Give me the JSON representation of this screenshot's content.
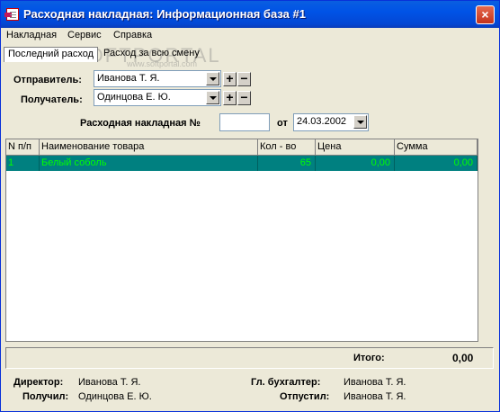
{
  "window": {
    "title": "Расходная накладная: Информационная база #1",
    "close_glyph": "×"
  },
  "menu": [
    "Накладная",
    "Сервис",
    "Справка"
  ],
  "tabs": [
    "Последний расход",
    "Расход за всю смену"
  ],
  "watermark": {
    "text": "SOFTPORTAL",
    "sub": "www.softportal.com"
  },
  "form": {
    "sender_label": "Отправитель:",
    "sender_value": "Иванова Т. Я.",
    "recipient_label": "Получатель:",
    "recipient_value": "Одинцова Е. Ю.",
    "plus_glyph": "+",
    "minus_glyph": "−",
    "invoice_label": "Расходная накладная №",
    "invoice_number": "",
    "date_label": "от",
    "date_value": "24.03.2002"
  },
  "grid": {
    "columns": [
      "N п/п",
      "Наименование товара",
      "Кол - во",
      "Цена",
      "Сумма"
    ],
    "rows": [
      {
        "n": "1",
        "name": "Белый соболь",
        "qty": "65",
        "price": "0,00",
        "sum": "0,00"
      }
    ]
  },
  "total": {
    "label": "Итого:",
    "value": "0,00"
  },
  "footer": {
    "director_label": "Директор:",
    "director_value": "Иванова Т. Я.",
    "accountant_label": "Гл. бухгалтер:",
    "accountant_value": "Иванова Т. Я.",
    "received_label": "Получил:",
    "received_value": "Одинцова Е. Ю.",
    "released_label": "Отпустил:",
    "released_value": "Иванова Т. Я."
  },
  "colors": {
    "title_bar": "#0053e6",
    "row_highlight": "#008080",
    "row_text": "#00ff00"
  }
}
